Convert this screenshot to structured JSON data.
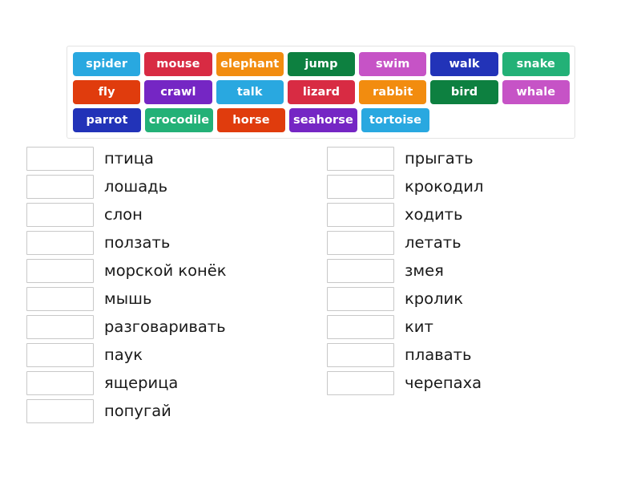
{
  "page": {
    "background_color": "#ffffff",
    "type": "vocabulary-matching-exercise"
  },
  "word_bank": {
    "name": "word-bank",
    "border_color": "#e3e3e3",
    "rows": [
      [
        {
          "label": "spider",
          "color": "#29a8e0"
        },
        {
          "label": "mouse",
          "color": "#d82b43"
        },
        {
          "label": "elephant",
          "color": "#f28c0f"
        },
        {
          "label": "jump",
          "color": "#0d8040"
        },
        {
          "label": "swim",
          "color": "#c653c6"
        },
        {
          "label": "walk",
          "color": "#2233b8"
        },
        {
          "label": "snake",
          "color": "#23b177"
        }
      ],
      [
        {
          "label": "fly",
          "color": "#e03c0d"
        },
        {
          "label": "crawl",
          "color": "#7526c4"
        },
        {
          "label": "talk",
          "color": "#29a8e0"
        },
        {
          "label": "lizard",
          "color": "#d82b43"
        },
        {
          "label": "rabbit",
          "color": "#f28c0f"
        },
        {
          "label": "bird",
          "color": "#0d8040"
        },
        {
          "label": "whale",
          "color": "#c653c6"
        }
      ],
      [
        {
          "label": "parrot",
          "color": "#2233b8"
        },
        {
          "label": "crocodile",
          "color": "#23b177"
        },
        {
          "label": "horse",
          "color": "#e03c0d"
        },
        {
          "label": "seahorse",
          "color": "#7526c4"
        },
        {
          "label": "tortoise",
          "color": "#29a8e0"
        }
      ]
    ]
  },
  "answers": {
    "left_column": [
      {
        "slot_value": "",
        "label": "птица"
      },
      {
        "slot_value": "",
        "label": "лошадь"
      },
      {
        "slot_value": "",
        "label": "слон"
      },
      {
        "slot_value": "",
        "label": "ползать"
      },
      {
        "slot_value": "",
        "label": "морской конёк"
      },
      {
        "slot_value": "",
        "label": "мышь"
      },
      {
        "slot_value": "",
        "label": "разговаривать"
      },
      {
        "slot_value": "",
        "label": "паук"
      },
      {
        "slot_value": "",
        "label": "ящерица"
      },
      {
        "slot_value": "",
        "label": "попугай"
      }
    ],
    "right_column": [
      {
        "slot_value": "",
        "label": "прыгать"
      },
      {
        "slot_value": "",
        "label": "крокодил"
      },
      {
        "slot_value": "",
        "label": "ходить"
      },
      {
        "slot_value": "",
        "label": "летать"
      },
      {
        "slot_value": "",
        "label": "змея"
      },
      {
        "slot_value": "",
        "label": "кролик"
      },
      {
        "slot_value": "",
        "label": "кит"
      },
      {
        "slot_value": "",
        "label": "плавать"
      },
      {
        "slot_value": "",
        "label": "черепаха"
      }
    ]
  }
}
